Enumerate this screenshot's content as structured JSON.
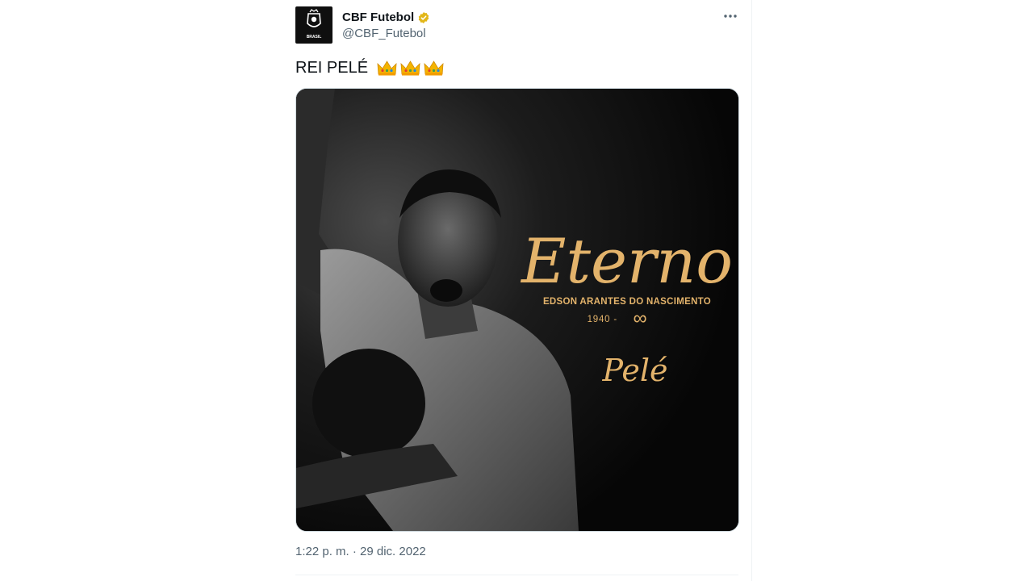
{
  "tweet": {
    "author": {
      "display_name": "CBF Futebol",
      "handle": "@CBF_Futebol",
      "verified": true,
      "avatar_icon": "cbf-crest-icon",
      "avatar_caption": "BRASIL"
    },
    "more_icon": "more-dots-icon",
    "text": "REI PELÉ",
    "emojis": [
      "crown",
      "crown",
      "crown"
    ],
    "media": {
      "title": "Eterno",
      "subtitle": "EDSON ARANTES DO NASCIMENTO",
      "years": "1940 -",
      "infinity": "∞",
      "signature": "Pelé"
    },
    "timestamp": "1:22 p. m. · 29 dic. 2022"
  },
  "colors": {
    "gold": "#e3b36b",
    "verified_gold": "#e2b719",
    "text_primary": "#0f1419",
    "text_secondary": "#536471"
  }
}
